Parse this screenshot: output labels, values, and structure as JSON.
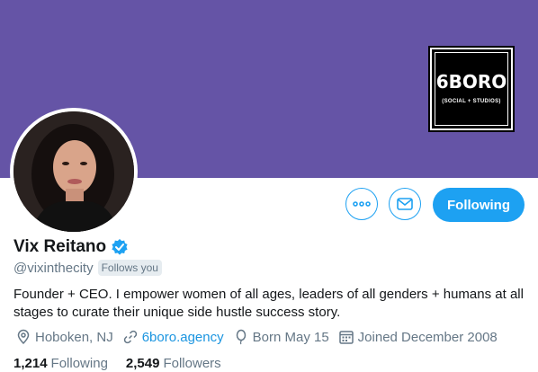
{
  "header": {
    "banner_color": "#6554a6",
    "logo": {
      "title": "6BORO",
      "subtitle": "(SOCIAL + STUDIOS)"
    }
  },
  "profile": {
    "name": "Vix Reitano",
    "verified": true,
    "handle": "@vixinthecity",
    "follows_you_label": "Follows you",
    "bio": "Founder + CEO. I empower women of all ages, leaders of all genders + humans at all stages to curate their unique side hustle success story.",
    "location": "Hoboken, NJ",
    "website": "6boro.agency",
    "birthday": "Born May 15",
    "joined": "Joined December 2008",
    "following_count": "1,214",
    "following_label": "Following",
    "followers_count": "2,549",
    "followers_label": "Followers"
  },
  "actions": {
    "more_icon": "more-icon",
    "message_icon": "envelope-icon",
    "following_button_label": "Following"
  },
  "colors": {
    "accent": "#1da1f2",
    "link": "#1b95e0",
    "secondary_text": "#657786",
    "primary_text": "#14171a"
  }
}
